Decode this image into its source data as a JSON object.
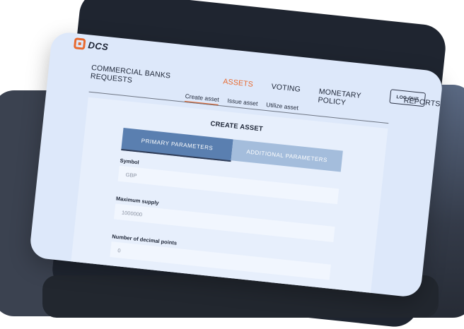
{
  "logo": {
    "text": "DCS",
    "color": "#e8692e"
  },
  "nav": {
    "items": [
      {
        "label": "COMMERCIAL BANKS REQUESTS",
        "active": false
      },
      {
        "label": "ASSETS",
        "active": true
      },
      {
        "label": "VOTING",
        "active": false
      },
      {
        "label": "MONETARY POLICY",
        "active": false
      },
      {
        "label": "REPORTS",
        "active": false
      }
    ],
    "logout_label": "LOG OUT"
  },
  "subtabs": [
    {
      "label": "Create asset",
      "active": true
    },
    {
      "label": "Issue asset",
      "active": false
    },
    {
      "label": "Utilize asset",
      "active": false
    }
  ],
  "form": {
    "title": "CREATE ASSET",
    "tabs": [
      {
        "label": "PRIMARY PARAMETERS",
        "active": true
      },
      {
        "label": "ADDITIONAL PARAMETERS",
        "active": false
      }
    ],
    "fields": [
      {
        "label": "Symbol",
        "placeholder": "GBP"
      },
      {
        "label": "Maximum supply",
        "placeholder": "1000000"
      },
      {
        "label": "Number of decimal points",
        "placeholder": "0"
      }
    ]
  },
  "colors": {
    "accent": "#e8692e",
    "screen_bg": "#dde8fa",
    "tab_primary": "#5a7fb0",
    "tab_secondary": "#a4bddc"
  }
}
